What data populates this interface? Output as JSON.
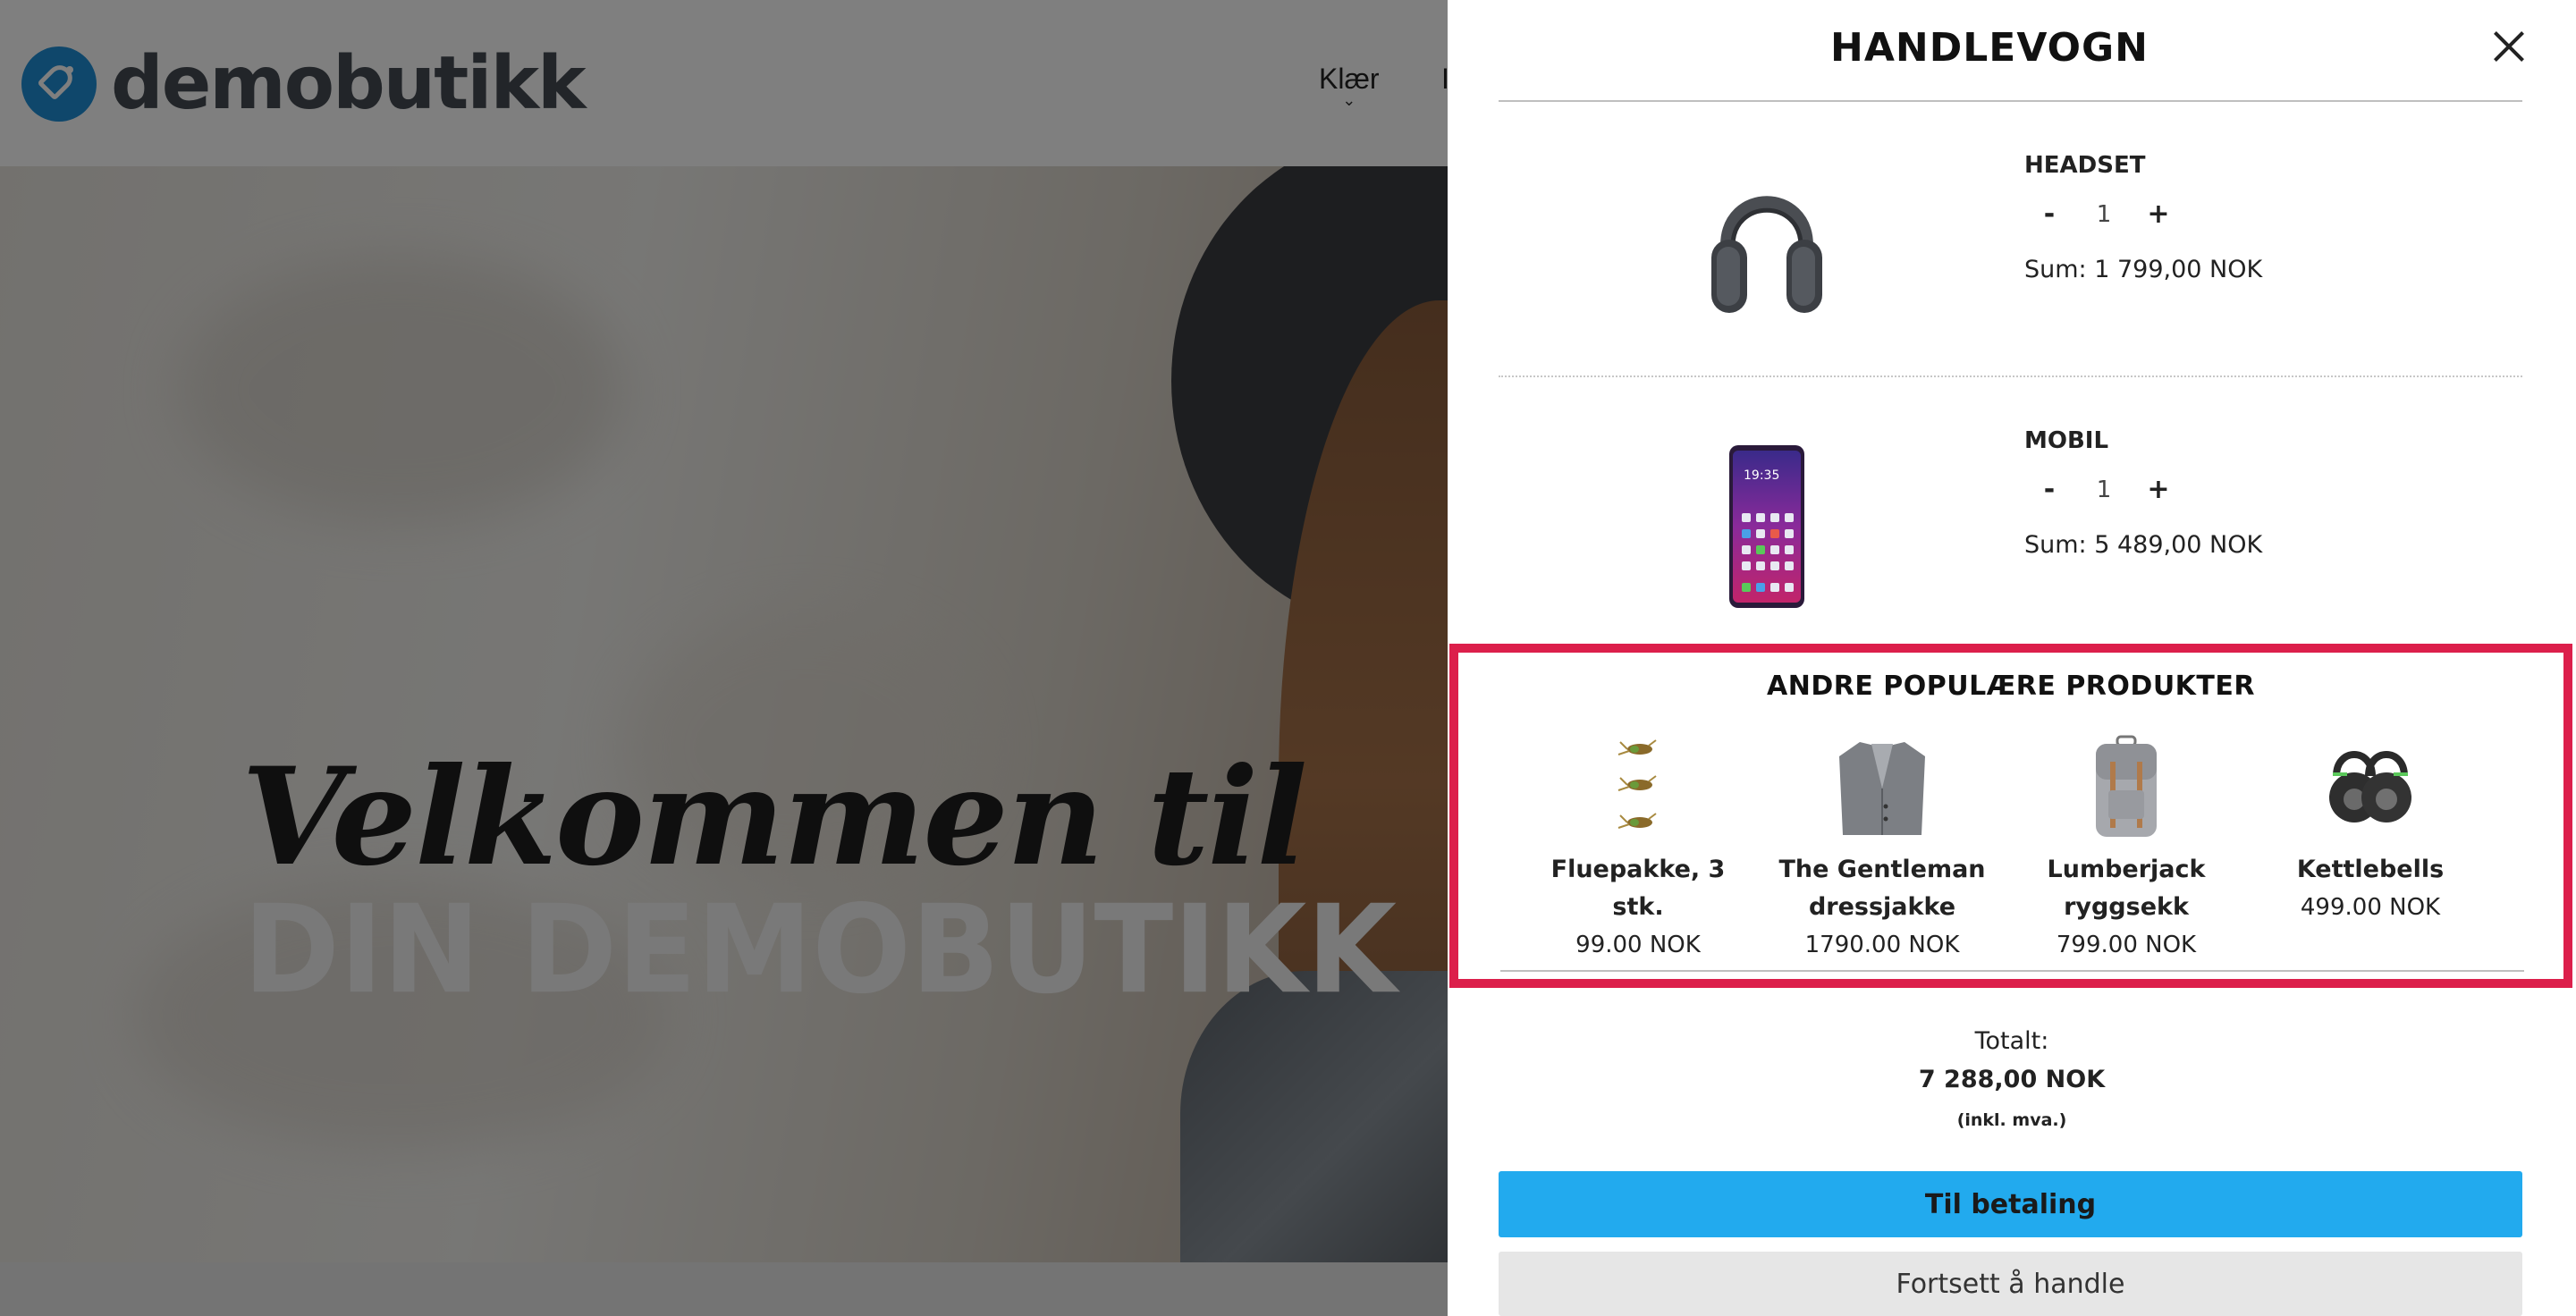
{
  "store": {
    "logo_text": "demobutikk",
    "nav": [
      {
        "label": "Klær"
      },
      {
        "label": "I"
      }
    ],
    "hero_script": "Velkommen til",
    "hero_big": "DIN DEMOBUTIKK"
  },
  "cart": {
    "title": "HANDLEVOGN",
    "items": [
      {
        "name": "HEADSET",
        "qty": "1",
        "minus": "-",
        "plus": "+",
        "sum": "Sum: 1 799,00 NOK",
        "icon": "headset-image"
      },
      {
        "name": "MOBIL",
        "qty": "1",
        "minus": "-",
        "plus": "+",
        "sum": "Sum: 5 489,00 NOK",
        "icon": "phone-image"
      }
    ],
    "popular": {
      "title": "ANDRE POPULÆRE PRODUKTER",
      "products": [
        {
          "name": "Fluepakke, 3 stk.",
          "price": "99.00 NOK",
          "icon": "fishing-flies-image"
        },
        {
          "name": "The Gentleman dressjakke",
          "price": "1790.00 NOK",
          "icon": "suit-jacket-image"
        },
        {
          "name": "Lumberjack ryggsekk",
          "price": "799.00 NOK",
          "icon": "backpack-image"
        },
        {
          "name": "Kettlebells",
          "price": "499.00 NOK",
          "icon": "kettlebells-image"
        }
      ]
    },
    "totals": {
      "label": "Totalt:",
      "value": "7 288,00 NOK",
      "note": "(inkl. mva.)"
    },
    "buttons": {
      "checkout": "Til betaling",
      "continue": "Fortsett å handle"
    }
  },
  "colors": {
    "highlight": "#dc1f4b",
    "checkout_button": "#22aaee",
    "continue_button": "#e6e6e6",
    "logo_blue": "#1f8fd6"
  }
}
